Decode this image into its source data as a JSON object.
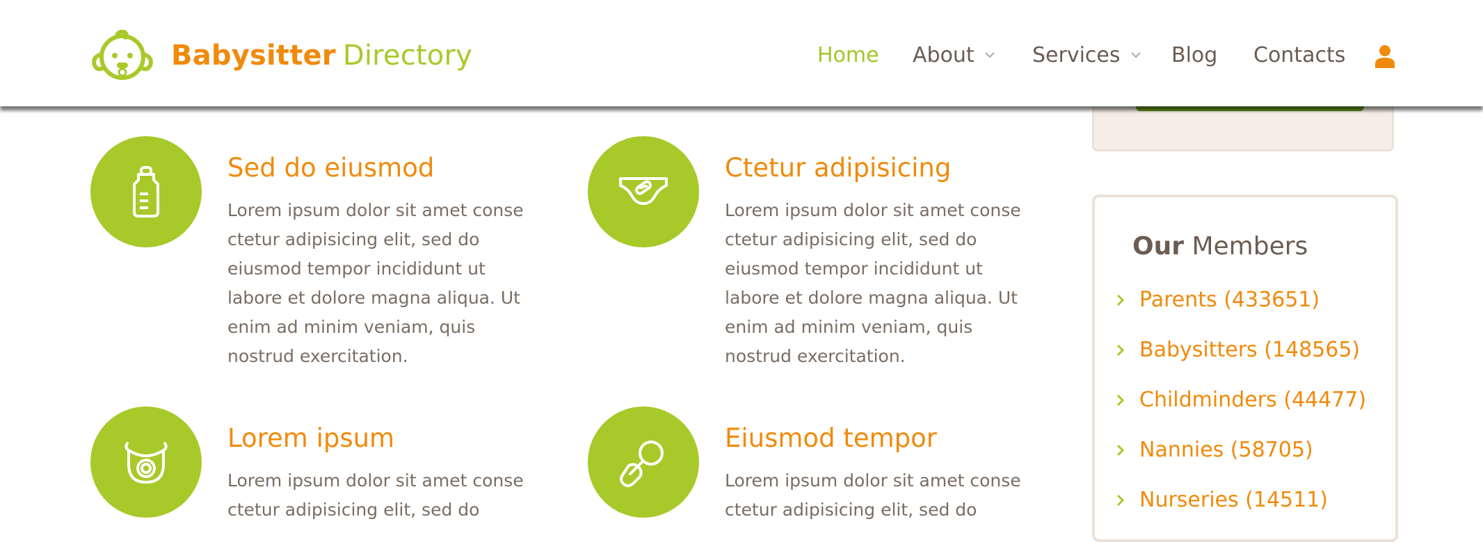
{
  "brand": {
    "name_bold": "Babysitter",
    "name_light": "Directory"
  },
  "nav": {
    "items": [
      {
        "label": "Home",
        "active": true,
        "has_dropdown": false
      },
      {
        "label": "About",
        "active": false,
        "has_dropdown": true
      },
      {
        "label": "Services",
        "active": false,
        "has_dropdown": true
      },
      {
        "label": "Blog",
        "active": false,
        "has_dropdown": false
      },
      {
        "label": "Contacts",
        "active": false,
        "has_dropdown": false
      }
    ],
    "user_icon": "user-icon"
  },
  "features": [
    {
      "title": "Sed do eiusmod",
      "icon": "baby-bottle-icon",
      "body": "Lorem ipsum dolor sit amet conse ctetur adipisicing elit, sed do eiusmod tempor incididunt ut labore et dolore magna aliqua. Ut enim ad minim veniam, quis nostrud exercitation."
    },
    {
      "title": "Ctetur adipisicing",
      "icon": "diaper-icon",
      "body": "Lorem ipsum dolor sit amet conse ctetur adipisicing elit, sed do eiusmod tempor incididunt ut labore et dolore magna aliqua. Ut enim ad minim veniam, quis nostrud exercitation."
    },
    {
      "title": "Lorem ipsum",
      "icon": "bib-icon",
      "body": "Lorem ipsum dolor sit amet conse ctetur adipisicing elit, sed do"
    },
    {
      "title": "Eiusmod tempor",
      "icon": "pacifier-icon",
      "body": "Lorem ipsum dolor sit amet conse ctetur adipisicing elit, sed do"
    }
  ],
  "members": {
    "title_bold": "Our",
    "title_light": "Members",
    "items": [
      {
        "label": "Parents (433651)"
      },
      {
        "label": "Babysitters (148565)"
      },
      {
        "label": "Childminders (44477)"
      },
      {
        "label": "Nannies (58705)"
      },
      {
        "label": "Nurseries (14511)"
      }
    ]
  },
  "colors": {
    "accent_green": "#a8c92a",
    "accent_orange": "#f08a0b",
    "text_brown": "#6b5c52",
    "body_text": "#7b6d63"
  }
}
